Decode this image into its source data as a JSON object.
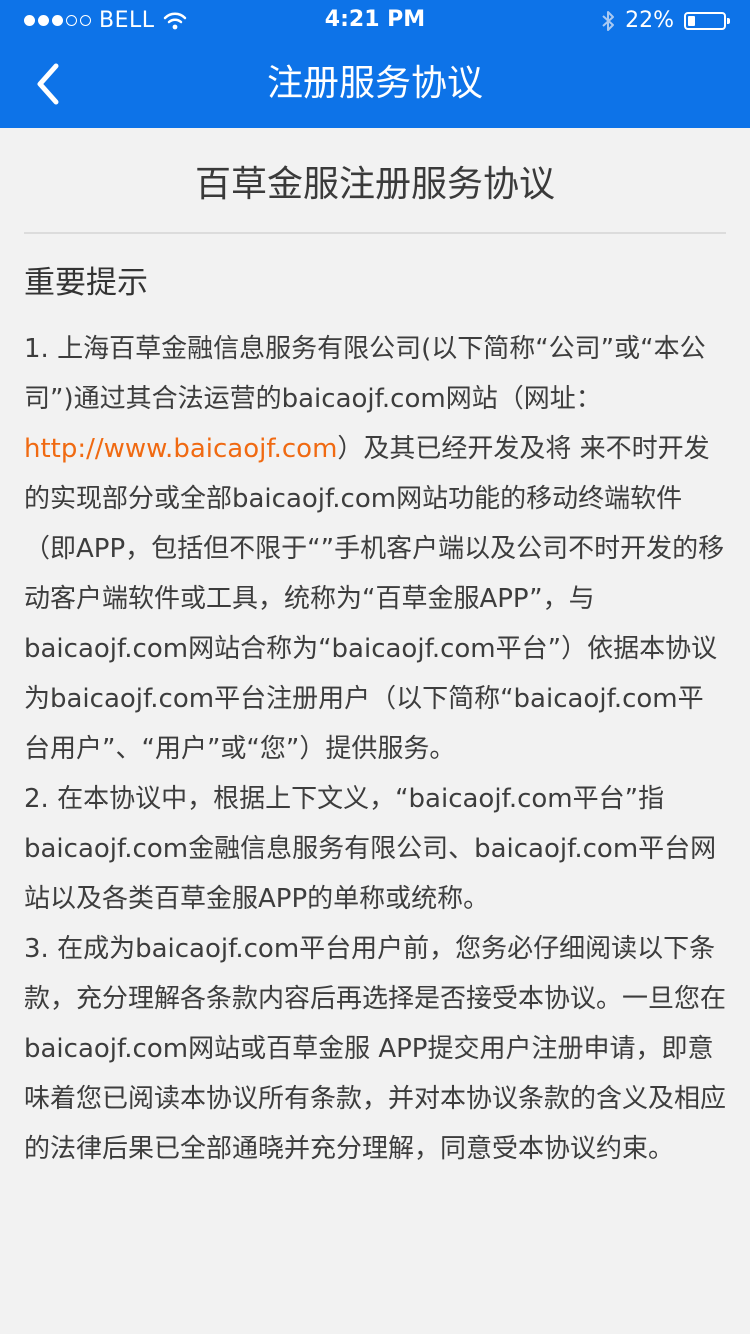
{
  "status_bar": {
    "signal_filled": 3,
    "signal_total": 5,
    "carrier": "BELL",
    "time": "4:21 PM",
    "battery": "22%",
    "battery_level": 0.22
  },
  "navbar": {
    "title": "注册服务协议"
  },
  "document": {
    "title": "百草金服注册服务协议",
    "section_heading": "重要提示",
    "p1_before": "1. 上海百草金融信息服务有限公司(以下简称“公司”或“本公司”)通过其合法运营的baicaojf.com网站（网址：",
    "p1_link": "http://www.baicaojf.com",
    "p1_after": "）及其已经开发及将 来不时开发的实现部分或全部baicaojf.com网站功能的移动终端软件（即APP，包括但不限于“”手机客户端以及公司不时开发的移动客户端软件或工具，统称为“百草金服APP”，与baicaojf.com网站合称为“baicaojf.com平台”）依据本协议为baicaojf.com平台注册用户（以下简称“baicaojf.com平台用户”、“用户”或“您”）提供服务。",
    "p2": "2. 在本协议中，根据上下文义，“baicaojf.com平台”指baicaojf.com金融信息服务有限公司、baicaojf.com平台网站以及各类百草金服APP的单称或统称。",
    "p3": "3. 在成为baicaojf.com平台用户前，您务必仔细阅读以下条款，充分理解各条款内容后再选择是否接受本协议。一旦您在baicaojf.com网站或百草金服 APP提交用户注册申请，即意味着您已阅读本协议所有条款，并对本协议条款的含义及相应的法律后果已全部通晓并充分理解，同意受本协议约束。"
  },
  "colors": {
    "header_bg": "#0d73e8",
    "page_bg": "#f2f2f2",
    "link": "#f06a12",
    "text": "#3d3d3d"
  },
  "icons": [
    "wifi-icon",
    "bluetooth-icon",
    "battery-icon",
    "back-chevron-icon"
  ]
}
